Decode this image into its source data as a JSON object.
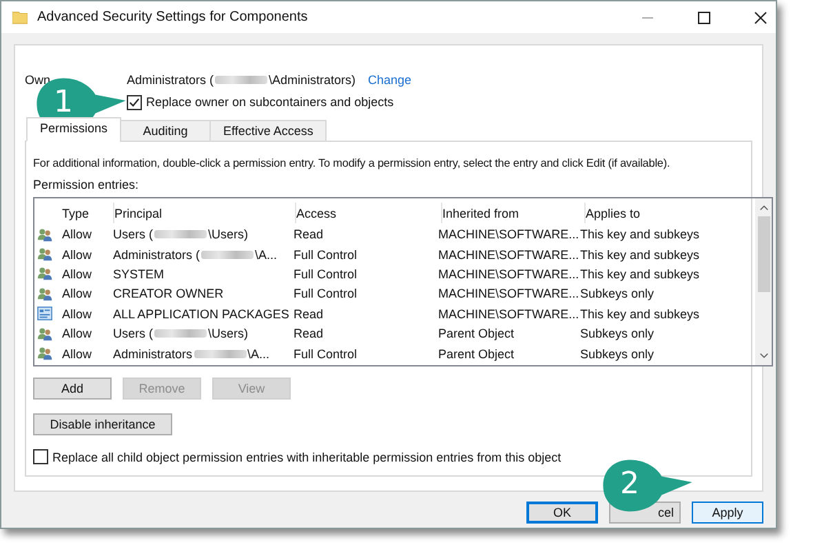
{
  "window": {
    "title": "Advanced Security Settings for Components"
  },
  "owner": {
    "label": "Own",
    "value_before": "Administrators (",
    "value_after": "\\Administrators)",
    "link": "Change"
  },
  "replace_owner": {
    "label": "Replace owner on subcontainers and objects",
    "checked": true
  },
  "tabs": [
    {
      "label": "Permissions",
      "selected": true
    },
    {
      "label": "Auditing",
      "selected": false
    },
    {
      "label": "Effective Access",
      "selected": false
    }
  ],
  "info": "For additional information, double-click a permission entry. To modify a permission entry, select the entry and click Edit (if available).",
  "entries_label": "Permission entries:",
  "table": {
    "columns": [
      "Type",
      "Principal",
      "Access",
      "Inherited from",
      "Applies to"
    ],
    "rows": [
      {
        "kind": "group",
        "type": "Allow",
        "principal": [
          "Users (",
          "\\Users)"
        ],
        "access": "Read",
        "inherited": "MACHINE\\SOFTWARE...",
        "applies": "This key and subkeys"
      },
      {
        "kind": "group",
        "type": "Allow",
        "principal": [
          "Administrators (",
          "\\A..."
        ],
        "access": "Full Control",
        "inherited": "MACHINE\\SOFTWARE...",
        "applies": "This key and subkeys"
      },
      {
        "kind": "group",
        "type": "Allow",
        "principal": [
          "SYSTEM"
        ],
        "access": "Full Control",
        "inherited": "MACHINE\\SOFTWARE...",
        "applies": "This key and subkeys"
      },
      {
        "kind": "group",
        "type": "Allow",
        "principal": [
          "CREATOR OWNER"
        ],
        "access": "Full Control",
        "inherited": "MACHINE\\SOFTWARE...",
        "applies": "Subkeys only"
      },
      {
        "kind": "packages",
        "type": "Allow",
        "principal": [
          "ALL APPLICATION PACKAGES"
        ],
        "access": "Read",
        "inherited": "MACHINE\\SOFTWARE...",
        "applies": "This key and subkeys"
      },
      {
        "kind": "group",
        "type": "Allow",
        "principal": [
          "Users (",
          "\\Users)"
        ],
        "access": "Read",
        "inherited": "Parent Object",
        "applies": "Subkeys only"
      },
      {
        "kind": "group",
        "type": "Allow",
        "principal": [
          "Administrators ",
          "\\A..."
        ],
        "access": "Full Control",
        "inherited": "Parent Object",
        "applies": "Subkeys only"
      }
    ]
  },
  "entry_buttons": [
    {
      "label": "Add",
      "disabled": false
    },
    {
      "label": "Remove",
      "disabled": true
    },
    {
      "label": "View",
      "disabled": true
    }
  ],
  "inheritance_button": "Disable inheritance",
  "replace_child": {
    "label": "Replace all child object permission entries with inheritable permission entries from this object",
    "checked": false
  },
  "dialog_buttons": [
    {
      "label": "OK",
      "default": true
    },
    {
      "label": "cel",
      "default": false
    },
    {
      "label": "Apply",
      "default": false
    }
  ],
  "callouts": [
    {
      "number": "1"
    },
    {
      "number": "2"
    }
  ]
}
